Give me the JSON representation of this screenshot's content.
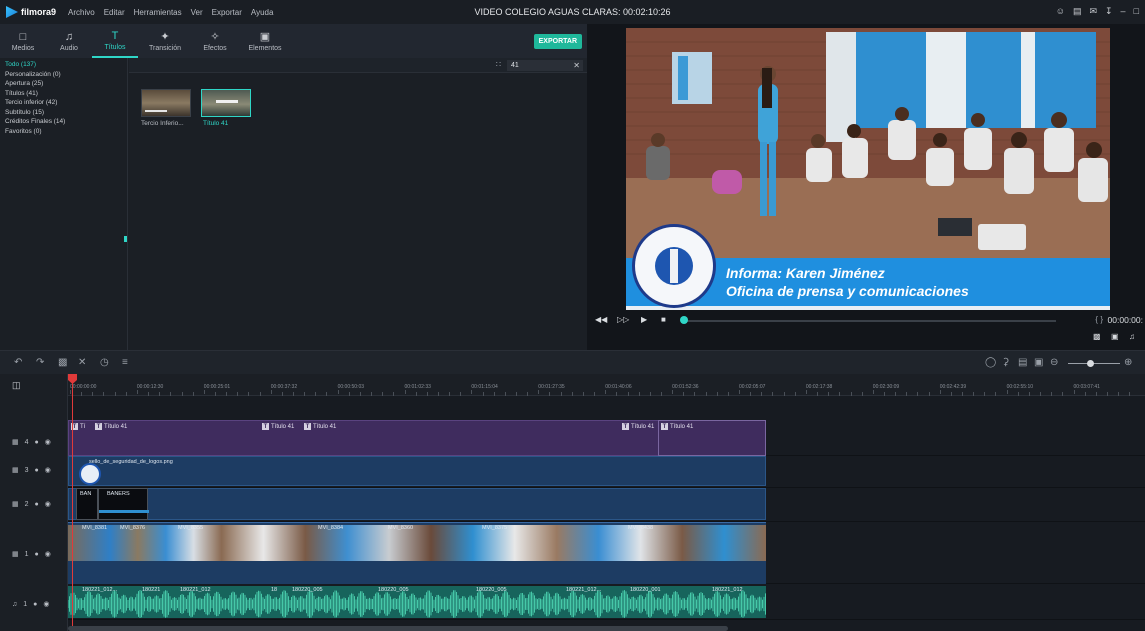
{
  "app": {
    "brand": "filmora9",
    "menu": [
      "Archivo",
      "Editar",
      "Herramientas",
      "Ver",
      "Exportar",
      "Ayuda"
    ],
    "project_title": "VIDEO COLEGIO AGUAS CLARAS: 00:02:10:26"
  },
  "tabs": [
    {
      "label": "Medios",
      "icon": "folder-icon"
    },
    {
      "label": "Audio",
      "icon": "music-note-icon"
    },
    {
      "label": "Títulos",
      "icon": "title-text-icon",
      "active": true
    },
    {
      "label": "Transición",
      "icon": "transition-icon"
    },
    {
      "label": "Efectos",
      "icon": "effects-icon"
    },
    {
      "label": "Elementos",
      "icon": "elements-icon"
    }
  ],
  "export_label": "EXPORTAR",
  "categories": [
    "Todo (137)",
    "Personalización (0)",
    "Apertura (25)",
    "Títulos (41)",
    "Tercio inferior (42)",
    "Subtítulo (15)",
    "Créditos Finales (14)",
    "Favoritos (0)"
  ],
  "search": {
    "value": "41"
  },
  "thumbnails": [
    {
      "label": "Tercio Inferio..."
    },
    {
      "label": "Título 41"
    }
  ],
  "video": {
    "caption_line1": "Informa: Karen Jiménez",
    "caption_line2": "Oficina de prensa y comunicaciones"
  },
  "playback": {
    "timecode": "00:00:00:",
    "progress": 0.0
  },
  "ruler_labels": [
    "00:00:00:00",
    "00:00:12:30",
    "00:00:25:01",
    "00:00:37:32",
    "00:00:50:03",
    "00:01:02:33",
    "00:01:15:04",
    "00:01:27:35",
    "00:01:40:06",
    "00:01:52:36",
    "00:02:05:07",
    "00:02:17:38",
    "00:02:30:09",
    "00:02:42:39",
    "00:02:55:10",
    "00:03:07:41"
  ],
  "tracks": {
    "t4": {
      "num": "4",
      "clips": [
        "Tí",
        "Título 41",
        "Título 41",
        "Título 41",
        "Título 41",
        "Título 41"
      ]
    },
    "t3": {
      "num": "3",
      "clip": "sello_de_seguridad_de_logos.png"
    },
    "t2": {
      "num": "2",
      "clips": [
        "BAN",
        "BANERS"
      ]
    },
    "t1": {
      "num": "1",
      "clips": [
        "MVI_8381",
        "MVI_8376",
        "MVI_8355",
        "MVI_8384",
        "MVI_8360",
        "MVI_8375",
        "MVI_8438"
      ]
    },
    "a1": {
      "num": "1",
      "clips": [
        "180221_012...",
        "180221",
        "180221_012",
        "18",
        "180220_005",
        "180220_005",
        "180220_005",
        "180221_012...",
        "180220_001",
        "180221_012"
      ]
    }
  },
  "colors": {
    "accent": "#2fd6c7",
    "playhead": "#e03a3a",
    "title_track": "#3f2c5e",
    "video_track": "#1d3c63",
    "audio_track": "#17645c"
  }
}
